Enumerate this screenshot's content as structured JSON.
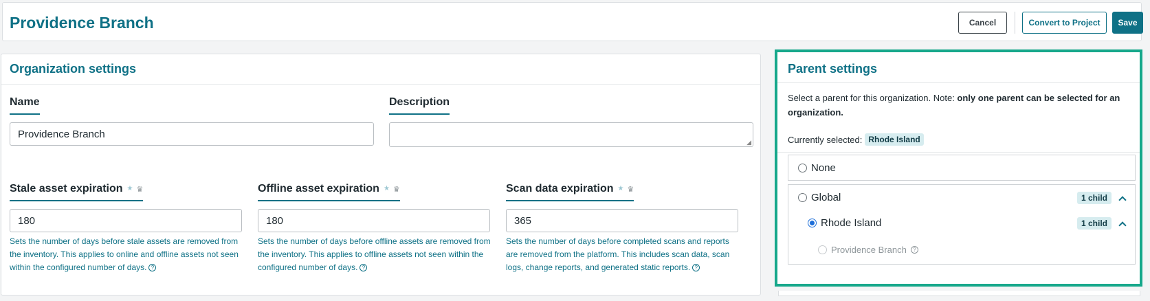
{
  "header": {
    "title": "Providence Branch",
    "cancel_label": "Cancel",
    "convert_label": "Convert to Project",
    "save_label": "Save"
  },
  "org_settings": {
    "title": "Organization settings",
    "name": {
      "label": "Name",
      "value": "Providence Branch"
    },
    "description": {
      "label": "Description",
      "value": ""
    },
    "stale": {
      "label": "Stale asset expiration",
      "value": "180",
      "help": "Sets the number of days before stale assets are removed from the inventory. This applies to online and offline assets not seen within the configured number of days."
    },
    "offline": {
      "label": "Offline asset expiration",
      "value": "180",
      "help": "Sets the number of days before offline assets are removed from the inventory. This applies to offline assets not seen within the configured number of days."
    },
    "scan": {
      "label": "Scan data expiration",
      "value": "365",
      "help": "Sets the number of days before completed scans and reports are removed from the platform. This includes scan data, scan logs, change reports, and generated static reports."
    },
    "icons": {
      "star": "★",
      "crown": "♛",
      "help": "?"
    }
  },
  "parent_settings": {
    "title": "Parent settings",
    "desc_plain": "Select a parent for this organization. Note: ",
    "desc_bold": "only one parent can be selected for an organization.",
    "current_label": "Currently selected:",
    "current_value": "Rhode Island",
    "options": [
      {
        "label": "None",
        "checked": false
      },
      {
        "label": "Global",
        "checked": false,
        "badge": "1 child"
      },
      {
        "label": "Rhode Island",
        "checked": true,
        "badge": "1 child"
      },
      {
        "label": "Providence Branch",
        "checked": false,
        "disabled": true
      }
    ]
  },
  "colors": {
    "accent": "#0f7186",
    "highlight_border": "#17a88b",
    "radio_selected": "#1d6ed8"
  }
}
